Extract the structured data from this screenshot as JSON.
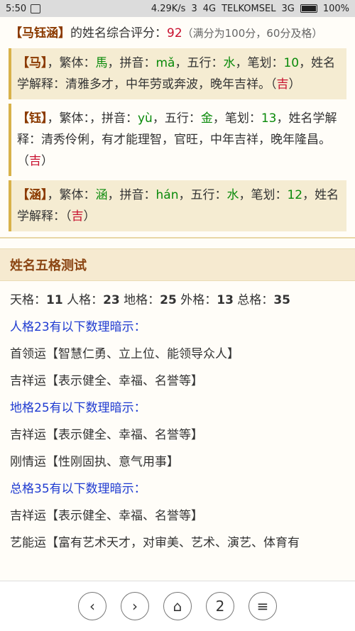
{
  "status_bar": {
    "time": "5:50",
    "speed": "4.29K/s",
    "sim1": "3",
    "network1": "4G",
    "carrier": "TELKOMSEL",
    "network2": "3G",
    "battery": "100%"
  },
  "score": {
    "name": "马钰涵",
    "text1": "的姓名综合评分：",
    "value": "92",
    "note": "（满分为100分，60分及格）"
  },
  "characters": [
    {
      "char": "马",
      "trad_label": "，繁体：",
      "trad": "馬",
      "pinyin_label": "，拼音：",
      "pinyin": "mǎ",
      "wuxing_label": "，五行：",
      "wuxing": "水",
      "stroke_label": "，笔划：",
      "strokes": "10",
      "explain_label": "，姓名学解释：",
      "explain": "清雅多才，中年劳或奔波，晚年吉祥。",
      "luck": "吉"
    },
    {
      "char": "钰",
      "trad_label": "，繁体：",
      "trad": "",
      "pinyin_label": "，拼音：",
      "pinyin": "yù",
      "wuxing_label": "，五行：",
      "wuxing": "金",
      "stroke_label": "，笔划：",
      "strokes": "13",
      "explain_label": "，姓名学解释：",
      "explain": "清秀伶俐，有才能理智，官旺，中年吉祥，晚年隆昌。",
      "luck": "吉"
    },
    {
      "char": "涵",
      "trad_label": "，繁体：",
      "trad": "涵",
      "pinyin_label": "，拼音：",
      "pinyin": "hán",
      "wuxing_label": "，五行：",
      "wuxing": "水",
      "stroke_label": "，笔划：",
      "strokes": "12",
      "explain_label": "，姓名学解释：",
      "explain": "",
      "luck": "吉"
    }
  ],
  "section": {
    "title": "姓名五格测试",
    "wuge": {
      "tian_label": "天格：",
      "tian": "11",
      "ren_label": " 人格：",
      "ren": "23",
      "di_label": " 地格：",
      "di": "25",
      "wai_label": " 外格：",
      "wai": "13",
      "zong_label": " 总格：",
      "zong": "35"
    },
    "lines": [
      {
        "text": "人格23有以下数理暗示：",
        "type": "blue"
      },
      {
        "text": "首领运【智慧仁勇、立上位、能领导众人】",
        "type": "normal"
      },
      {
        "text": "吉祥运【表示健全、幸福、名誉等】",
        "type": "normal"
      },
      {
        "text": "地格25有以下数理暗示：",
        "type": "blue"
      },
      {
        "text": "吉祥运【表示健全、幸福、名誉等】",
        "type": "normal"
      },
      {
        "text": "刚情运【性刚固执、意气用事】",
        "type": "normal"
      },
      {
        "text": "总格35有以下数理暗示：",
        "type": "blue"
      },
      {
        "text": "吉祥运【表示健全、幸福、名誉等】",
        "type": "normal"
      },
      {
        "text": "艺能运【富有艺术天才，对审美、艺术、演艺、体育有",
        "type": "normal"
      }
    ]
  },
  "bottom_bar": {
    "back": "‹",
    "forward": "›",
    "home": "⌂",
    "tabs": "2",
    "menu": "≡"
  }
}
